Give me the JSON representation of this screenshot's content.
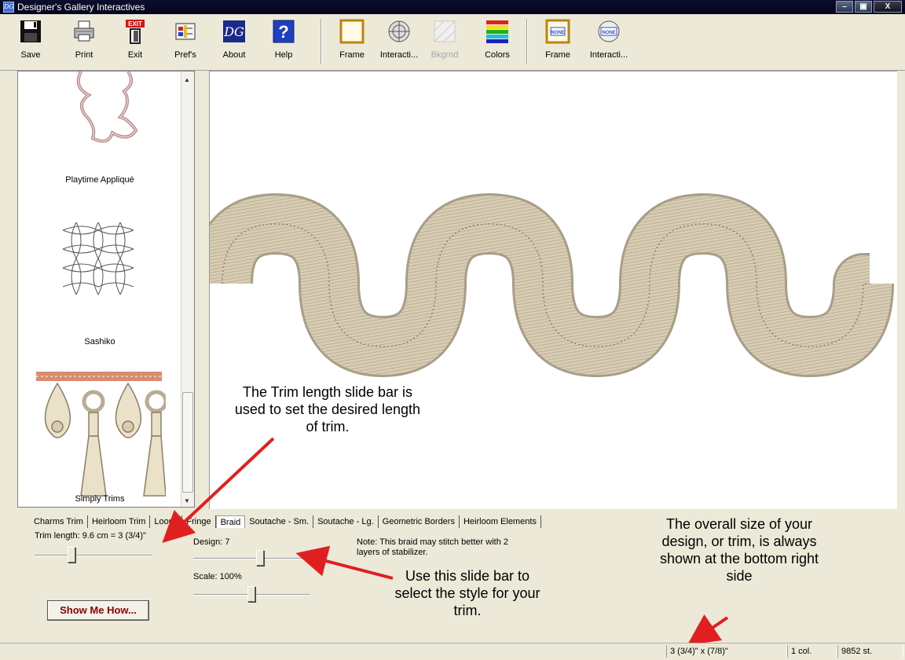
{
  "window": {
    "title": "Designer's Gallery Interactives",
    "icon_text": "DG",
    "controls": [
      "–",
      "▣",
      "X"
    ]
  },
  "toolbar": [
    {
      "label": "Save",
      "icon": "save-icon",
      "enabled": true
    },
    {
      "label": "Print",
      "icon": "print-icon",
      "enabled": true
    },
    {
      "label": "Exit",
      "icon": "exit-icon",
      "icon_text": "EXIT",
      "enabled": true
    },
    {
      "label": "Pref's",
      "icon": "preferences-icon",
      "enabled": true
    },
    {
      "label": "About",
      "icon": "about-icon",
      "icon_text": "DG",
      "enabled": true
    },
    {
      "label": "Help",
      "icon": "help-icon",
      "icon_text": "?",
      "enabled": true
    },
    {
      "label": "Frame",
      "icon": "frame-icon",
      "enabled": true
    },
    {
      "label": "Interacti...",
      "icon": "interactive-icon",
      "enabled": true
    },
    {
      "label": "Bkgrnd",
      "icon": "background-icon",
      "enabled": false
    },
    {
      "label": "Colors",
      "icon": "colors-icon",
      "enabled": true
    },
    {
      "label": "Frame",
      "icon": "frame-none-icon",
      "icon_text": "NONE",
      "enabled": true
    },
    {
      "label": "Interacti...",
      "icon": "interactive-none-icon",
      "icon_text": "NONE",
      "enabled": true
    }
  ],
  "gallery": {
    "items": [
      {
        "label": "Playtime Appliqué",
        "icon": "teddy-bear-applique-icon"
      },
      {
        "label": "Sashiko",
        "icon": "sashiko-pattern-icon"
      },
      {
        "label": "Simply Trims",
        "icon": "tassel-trim-icon"
      }
    ]
  },
  "tabs": [
    "Charms Trim",
    "Heirloom Trim",
    "Loops",
    "Fringe",
    "Braid",
    "Soutache - Sm.",
    "Soutache - Lg.",
    "Geometric Borders",
    "Heirloom Elements"
  ],
  "active_tab": "Braid",
  "controls": {
    "trim_length_label": "Trim length: 9.6 cm = 3 (3/4)\"",
    "trim_length_level": 0.3,
    "design_label": "Design: 7",
    "design_level": 0.58,
    "scale_label": "Scale: 100%",
    "scale_level": 0.5,
    "note": "Note: This braid may stitch better with 2 layers of stabilizer.",
    "show_me_how": "Show Me How..."
  },
  "annotations": {
    "trim_slider": "The Trim length slide bar is used to set the desired length of trim.",
    "design_slider": "Use this slide bar to select the style for your trim.",
    "overall_size": "The overall size of your design, or trim, is always shown at the bottom right side"
  },
  "status": {
    "size": "3 (3/4)\" x (7/8)\"",
    "colors": "1 col.",
    "stitches": "9852 st."
  },
  "colors": {
    "braid_fill": "#d8cdb2",
    "braid_stitch": "#a89e88",
    "arrow": "#e02020",
    "show_me_text": "#8b0000"
  }
}
